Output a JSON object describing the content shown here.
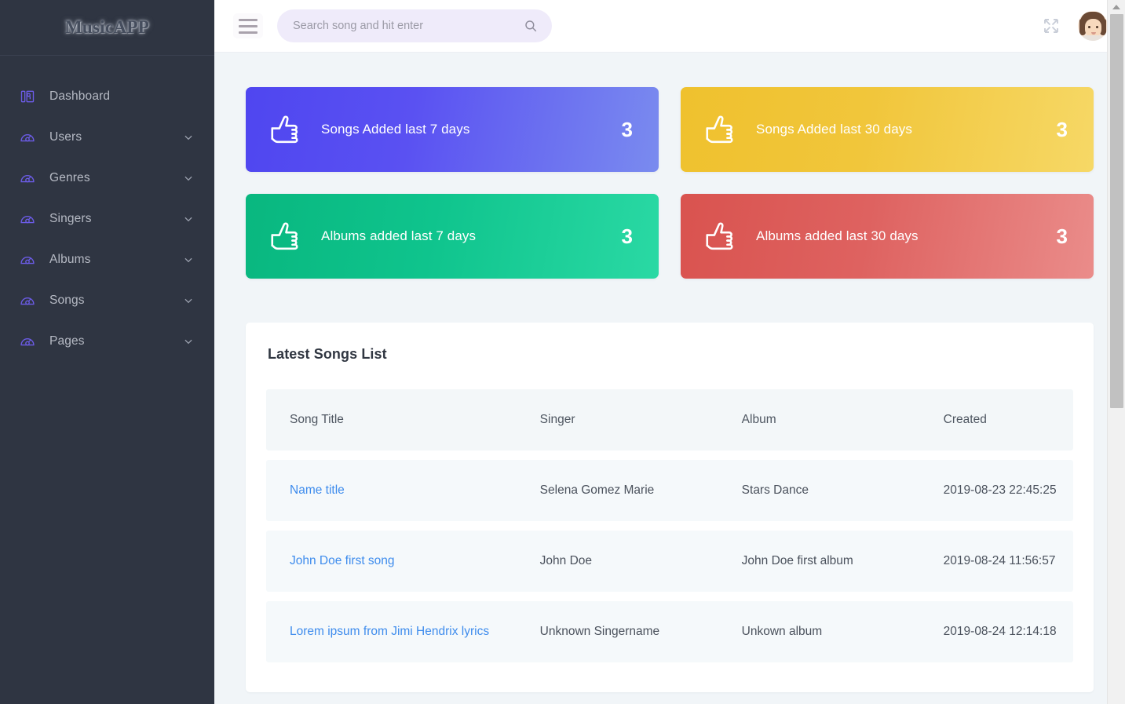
{
  "sidebar": {
    "logo": "MusicAPP",
    "items": [
      {
        "label": "Dashboard",
        "icon": "dashboard-icon",
        "expandable": false
      },
      {
        "label": "Users",
        "icon": "gauge-icon",
        "expandable": true
      },
      {
        "label": "Genres",
        "icon": "gauge-icon",
        "expandable": true
      },
      {
        "label": "Singers",
        "icon": "gauge-icon",
        "expandable": true
      },
      {
        "label": "Albums",
        "icon": "gauge-icon",
        "expandable": true
      },
      {
        "label": "Songs",
        "icon": "gauge-icon",
        "expandable": true
      },
      {
        "label": "Pages",
        "icon": "gauge-icon",
        "expandable": true
      }
    ]
  },
  "topbar": {
    "menu_icon": "hamburger-icon",
    "search": {
      "placeholder": "Search song and hit enter",
      "value": "",
      "icon": "search-icon"
    },
    "fullscreen_icon": "expand-arrows-icon",
    "avatar": "user-avatar"
  },
  "stats": [
    {
      "label": "Songs Added last 7 days",
      "value": "3",
      "color": "#4f46f0",
      "theme": "blue",
      "icon": "thumbs-up-icon"
    },
    {
      "label": "Songs Added last 30 days",
      "value": "3",
      "color": "#efc12e",
      "theme": "yellow",
      "icon": "thumbs-up-icon"
    },
    {
      "label": "Albums added last 7 days",
      "value": "3",
      "color": "#0fc48d",
      "theme": "green",
      "icon": "thumbs-up-icon"
    },
    {
      "label": "Albums added last 30 days",
      "value": "3",
      "color": "#d9534f",
      "theme": "red",
      "icon": "thumbs-up-icon"
    }
  ],
  "panel": {
    "title": "Latest Songs List",
    "columns": [
      "Song Title",
      "Singer",
      "Album",
      "Created"
    ],
    "rows": [
      {
        "title": "Name title",
        "singer": "Selena Gomez Marie",
        "album": "Stars Dance",
        "created": "2019-08-23 22:45:25"
      },
      {
        "title": "John Doe first song",
        "singer": "John Doe",
        "album": "John Doe first album",
        "created": "2019-08-24 11:56:57"
      },
      {
        "title": "Lorem ipsum from Jimi Hendrix lyrics",
        "singer": "Unknown Singername",
        "album": "Unkown album",
        "created": "2019-08-24 12:14:18"
      }
    ],
    "link_color": "#3e8ced"
  },
  "scrollbar": {
    "up_arrow": "scroll-up-arrow-icon"
  }
}
